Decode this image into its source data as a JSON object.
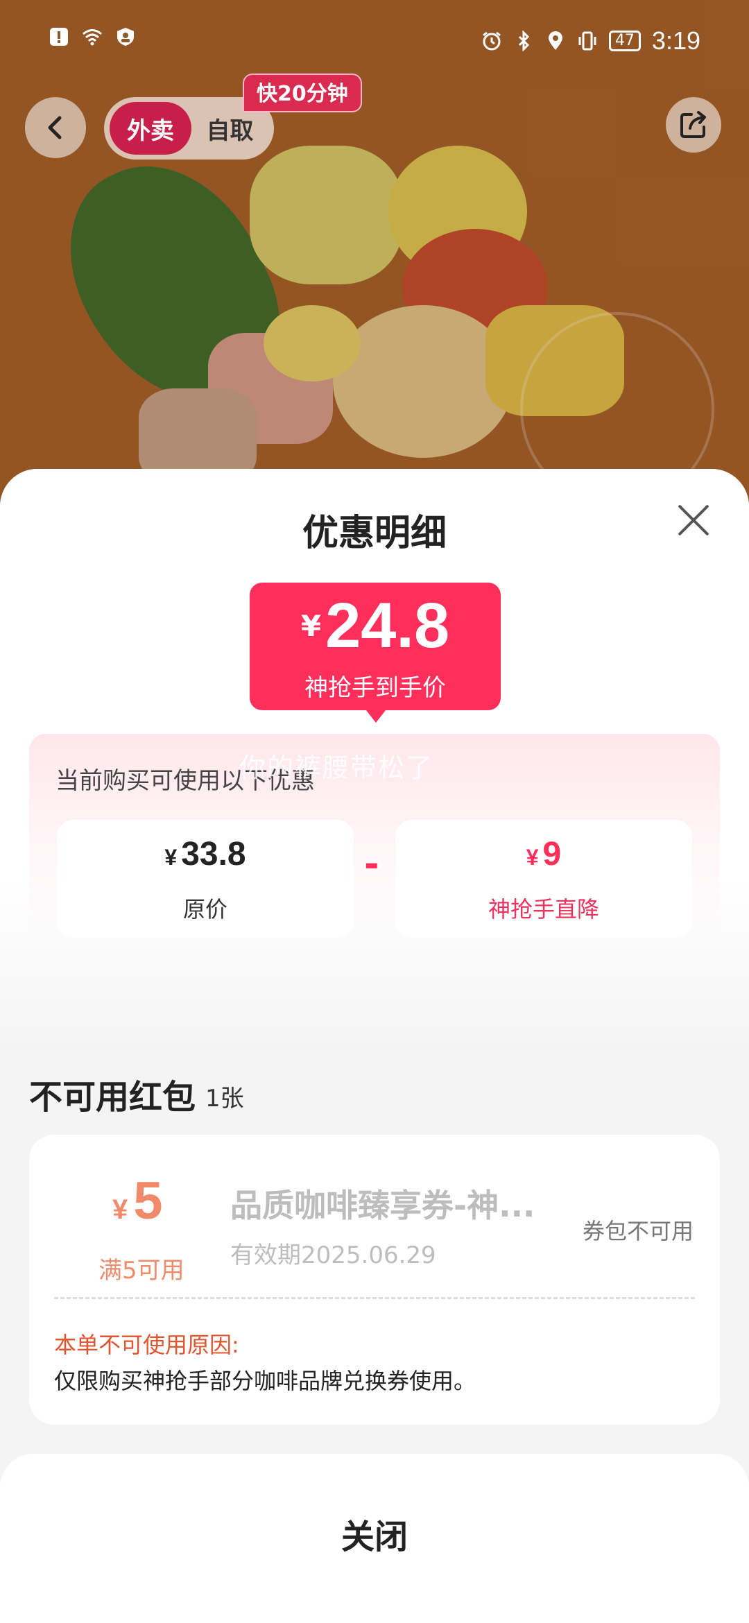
{
  "status_bar": {
    "time": "3:19",
    "battery": "47",
    "icons": [
      "alert-icon",
      "wifi-icon",
      "vpn-icon",
      "alarm-icon",
      "bluetooth-icon",
      "location-icon",
      "vibrate-icon"
    ]
  },
  "header": {
    "mode_active": "外卖",
    "mode_other": "自取",
    "fast_badge": "快20分钟"
  },
  "sheet": {
    "title": "优惠明细",
    "final_price": {
      "currency": "¥",
      "amount": "24.8",
      "label": "神抢手到手价"
    },
    "watermark": "你的裤腰带松了",
    "discount_hint": "当前购买可使用以下优惠",
    "original": {
      "currency": "¥",
      "amount": "33.8",
      "label": "原价"
    },
    "minus": "-",
    "reduction": {
      "currency": "¥",
      "amount": "9",
      "label": "神抢手直降"
    },
    "unavailable": {
      "title": "不可用红包",
      "count": "1张",
      "coupon": {
        "currency": "¥",
        "amount": "5",
        "condition": "满5可用",
        "name": "品质咖啡臻享券-神...",
        "validity": "有效期2025.06.29",
        "status": "券包不可用",
        "reason_title": "本单不可使用原因:",
        "reason": "仅限购买神抢手部分咖啡品牌兑换券使用。"
      }
    },
    "close_label": "关闭"
  },
  "colors": {
    "accent": "#ff2e5a",
    "coupon_orange": "#f08a6a",
    "reason_red": "#e0552e"
  }
}
